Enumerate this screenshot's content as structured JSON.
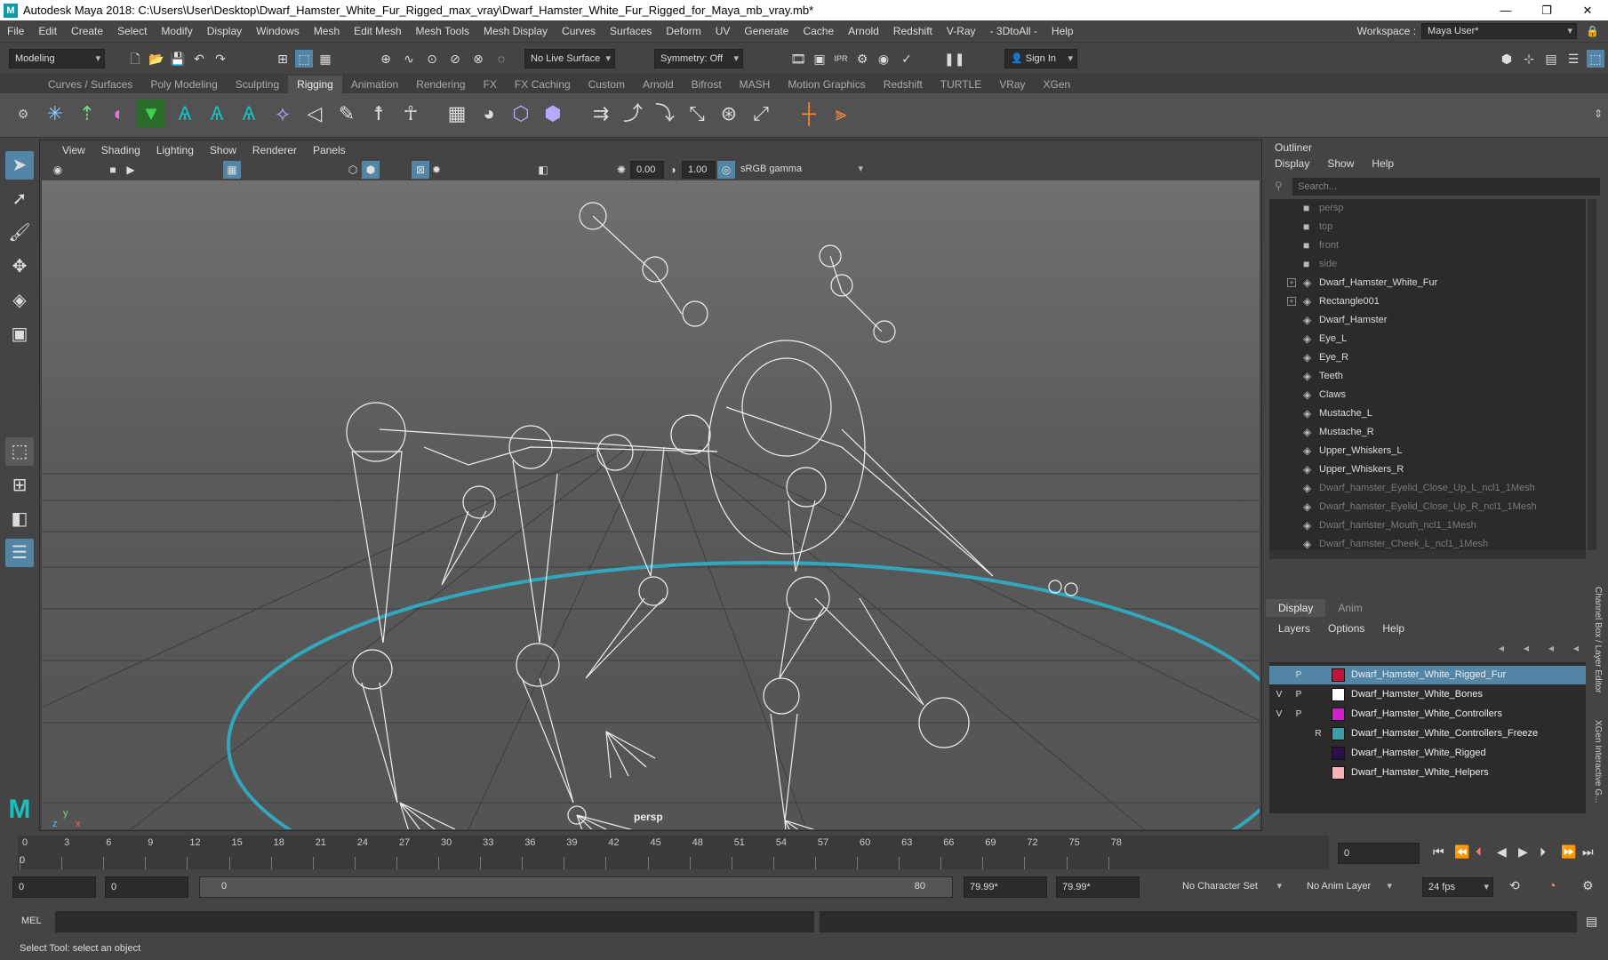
{
  "titlebar": {
    "logo": "M",
    "title": "Autodesk Maya 2018: C:\\Users\\User\\Desktop\\Dwarf_Hamster_White_Fur_Rigged_max_vray\\Dwarf_Hamster_White_Fur_Rigged_for_Maya_mb_vray.mb*",
    "minimize": "—",
    "maximize": "❐",
    "close": "✕"
  },
  "menubar": {
    "items": [
      "File",
      "Edit",
      "Create",
      "Select",
      "Modify",
      "Display",
      "Windows",
      "Mesh",
      "Edit Mesh",
      "Mesh Tools",
      "Mesh Display",
      "Curves",
      "Surfaces",
      "Deform",
      "UV",
      "Generate",
      "Cache",
      "Arnold",
      "Redshift",
      "V-Ray",
      "- 3DtoAll -",
      "Help"
    ],
    "workspace_label": "Workspace :",
    "workspace_value": "Maya User*"
  },
  "statusline": {
    "mode": "Modeling",
    "live_surface": "No Live Surface",
    "symmetry": "Symmetry: Off",
    "sign_in": "Sign In"
  },
  "shelf": {
    "tabs": [
      "Curves / Surfaces",
      "Poly Modeling",
      "Sculpting",
      "Rigging",
      "Animation",
      "Rendering",
      "FX",
      "FX Caching",
      "Custom",
      "Arnold",
      "Bifrost",
      "MASH",
      "Motion Graphics",
      "Redshift",
      "TURTLE",
      "VRay",
      "XGen"
    ],
    "active_tab": "Rigging"
  },
  "viewport": {
    "menu": [
      "View",
      "Shading",
      "Lighting",
      "Show",
      "Renderer",
      "Panels"
    ],
    "exposure": "0.00",
    "gamma": "1.00",
    "color_space": "sRGB gamma",
    "camera": "persp"
  },
  "outliner": {
    "title": "Outliner",
    "menu": [
      "Display",
      "Show",
      "Help"
    ],
    "search_placeholder": "Search...",
    "items": [
      {
        "label": "persp",
        "type": "camera",
        "dim": true,
        "expand": false
      },
      {
        "label": "top",
        "type": "camera",
        "dim": true,
        "expand": false
      },
      {
        "label": "front",
        "type": "camera",
        "dim": true,
        "expand": false
      },
      {
        "label": "side",
        "type": "camera",
        "dim": true,
        "expand": false
      },
      {
        "label": "Dwarf_Hamster_White_Fur",
        "type": "mesh",
        "dim": false,
        "expand": true
      },
      {
        "label": "Rectangle001",
        "type": "mesh",
        "dim": false,
        "expand": true
      },
      {
        "label": "Dwarf_Hamster",
        "type": "mesh",
        "dim": false,
        "expand": false
      },
      {
        "label": "Eye_L",
        "type": "mesh",
        "dim": false,
        "expand": false
      },
      {
        "label": "Eye_R",
        "type": "mesh",
        "dim": false,
        "expand": false
      },
      {
        "label": "Teeth",
        "type": "mesh",
        "dim": false,
        "expand": false
      },
      {
        "label": "Claws",
        "type": "mesh",
        "dim": false,
        "expand": false
      },
      {
        "label": "Mustache_L",
        "type": "mesh",
        "dim": false,
        "expand": false
      },
      {
        "label": "Mustache_R",
        "type": "mesh",
        "dim": false,
        "expand": false
      },
      {
        "label": "Upper_Whiskers_L",
        "type": "mesh",
        "dim": false,
        "expand": false
      },
      {
        "label": "Upper_Whiskers_R",
        "type": "mesh",
        "dim": false,
        "expand": false
      },
      {
        "label": "Dwarf_hamster_Eyelid_Close_Up_L_ncl1_1Mesh",
        "type": "mesh",
        "dim": true,
        "expand": false
      },
      {
        "label": "Dwarf_hamster_Eyelid_Close_Up_R_ncl1_1Mesh",
        "type": "mesh",
        "dim": true,
        "expand": false
      },
      {
        "label": "Dwarf_hamster_Mouth_ncl1_1Mesh",
        "type": "mesh",
        "dim": true,
        "expand": false
      },
      {
        "label": "Dwarf_hamster_Cheek_L_ncl1_1Mesh",
        "type": "mesh",
        "dim": true,
        "expand": false
      }
    ]
  },
  "layers": {
    "tabs": [
      "Display",
      "Anim"
    ],
    "active_tab": "Display",
    "menu": [
      "Layers",
      "Options",
      "Help"
    ],
    "items": [
      {
        "name": "Dwarf_Hamster_White_Rigged_Fur",
        "v": "",
        "p": "P",
        "r": "",
        "color": "#c0143c",
        "selected": true
      },
      {
        "name": "Dwarf_Hamster_White_Bones",
        "v": "V",
        "p": "P",
        "r": "",
        "color": "#ffffff",
        "selected": false
      },
      {
        "name": "Dwarf_Hamster_White_Controllers",
        "v": "V",
        "p": "P",
        "r": "",
        "color": "#d21ecd",
        "selected": false
      },
      {
        "name": "Dwarf_Hamster_White_Controllers_Freeze",
        "v": "",
        "p": "",
        "r": "R",
        "color": "#3aa0a8",
        "selected": false
      },
      {
        "name": "Dwarf_Hamster_White_Rigged",
        "v": "",
        "p": "",
        "r": "",
        "color": "#2a0f4a",
        "selected": false
      },
      {
        "name": "Dwarf_Hamster_White_Helpers",
        "v": "",
        "p": "",
        "r": "",
        "color": "#f5b0b8",
        "selected": false
      }
    ]
  },
  "sidetabs": [
    "Channel Box / Layer Editor",
    "XGen Interactive G..."
  ],
  "timeline": {
    "ticks": [
      "0",
      "3",
      "6",
      "9",
      "12",
      "15",
      "18",
      "21",
      "24",
      "27",
      "30",
      "33",
      "36",
      "39",
      "42",
      "45",
      "48",
      "51",
      "54",
      "57",
      "60",
      "63",
      "66",
      "69",
      "72",
      "75",
      "78"
    ],
    "current_frame": "0",
    "current_marker": "0"
  },
  "range": {
    "start": "0",
    "playback_start": "0",
    "slider_start": "0",
    "slider_end": "80",
    "playback_end": "79.99*",
    "end": "79.99*",
    "character_set": "No Character Set",
    "anim_layer": "No Anim Layer",
    "fps": "24 fps"
  },
  "command": {
    "label": "MEL"
  },
  "helpline": {
    "text": "Select Tool: select an object"
  }
}
